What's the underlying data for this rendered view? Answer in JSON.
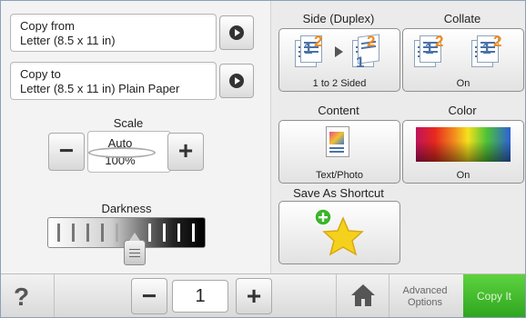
{
  "copy_from": {
    "line1": "Copy from",
    "line2": "Letter (8.5 x 11 in)"
  },
  "copy_to": {
    "line1": "Copy to",
    "line2": "Letter (8.5 x 11 in) Plain Paper"
  },
  "scale": {
    "label": "Scale",
    "mode": "Auto",
    "value": "100%"
  },
  "darkness": {
    "label": "Darkness"
  },
  "tiles": {
    "side": {
      "title": "Side (Duplex)",
      "caption": "1 to 2 Sided"
    },
    "collate": {
      "title": "Collate",
      "caption": "On"
    },
    "content": {
      "title": "Content",
      "caption": "Text/Photo"
    },
    "color": {
      "title": "Color",
      "caption": "On"
    },
    "shortcut": {
      "title": "Save As Shortcut"
    }
  },
  "bottom": {
    "help": "?",
    "copies": "1",
    "advanced_line1": "Advanced",
    "advanced_line2": "Options",
    "copy_it": "Copy It"
  },
  "colors": {
    "accent_green": "#3bb52a",
    "icon_blue": "#4a72a8",
    "icon_orange": "#f28a1e"
  }
}
